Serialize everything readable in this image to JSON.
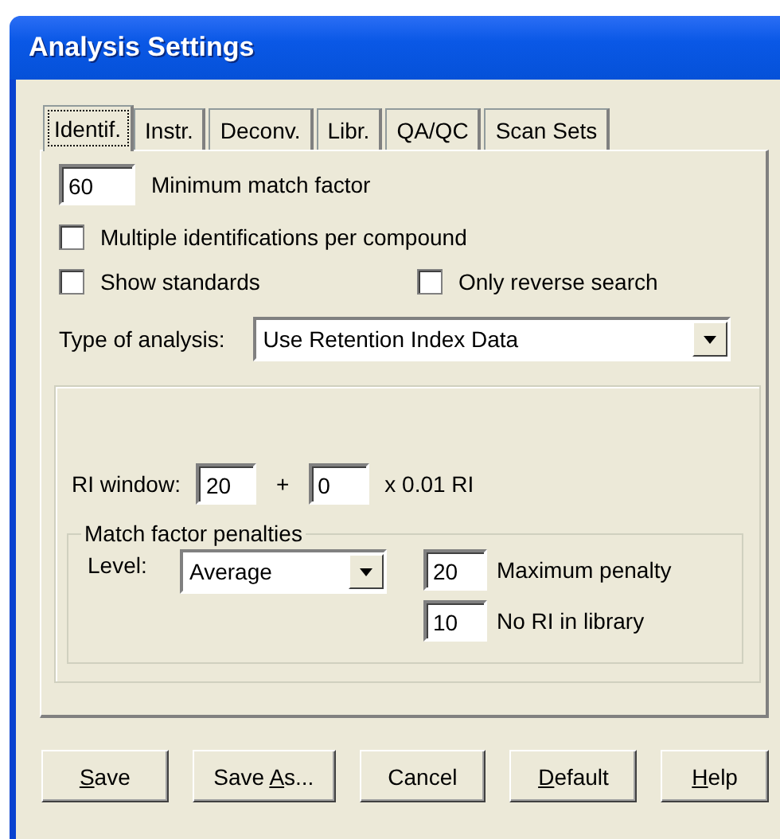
{
  "window": {
    "title": "Analysis Settings"
  },
  "tabs": [
    {
      "label": "Identif.",
      "selected": true
    },
    {
      "label": "Instr.",
      "selected": false
    },
    {
      "label": "Deconv.",
      "selected": false
    },
    {
      "label": "Libr.",
      "selected": false
    },
    {
      "label": "QA/QC",
      "selected": false
    },
    {
      "label": "Scan Sets",
      "selected": false
    }
  ],
  "min_match": {
    "value": "60",
    "label": "Minimum match factor"
  },
  "checkboxes": [
    {
      "label": "Multiple identifications per compound",
      "checked": false
    },
    {
      "label": "Show standards",
      "checked": false
    },
    {
      "label": "Only reverse search",
      "checked": false
    }
  ],
  "analysis_type": {
    "label": "Type of analysis:",
    "value": "Use Retention Index Data"
  },
  "ri_window": {
    "label": "RI window:",
    "value_1": "20",
    "operator": "+",
    "value_2": "0",
    "unit": "x 0.01 RI"
  },
  "penalties": {
    "title": "Match factor penalties",
    "level_label": "Level:",
    "level_value": "Average",
    "fields": [
      {
        "value": "20",
        "label": "Maximum penalty"
      },
      {
        "value": "10",
        "label": "No RI in library"
      }
    ]
  },
  "buttons": [
    {
      "access_key": "S",
      "after": "ave"
    },
    {
      "before": "Save ",
      "access_key": "A",
      "after": "s..."
    },
    {
      "before": "Cancel"
    },
    {
      "access_key": "D",
      "after": "efault"
    },
    {
      "access_key": "H",
      "after": "elp"
    }
  ]
}
